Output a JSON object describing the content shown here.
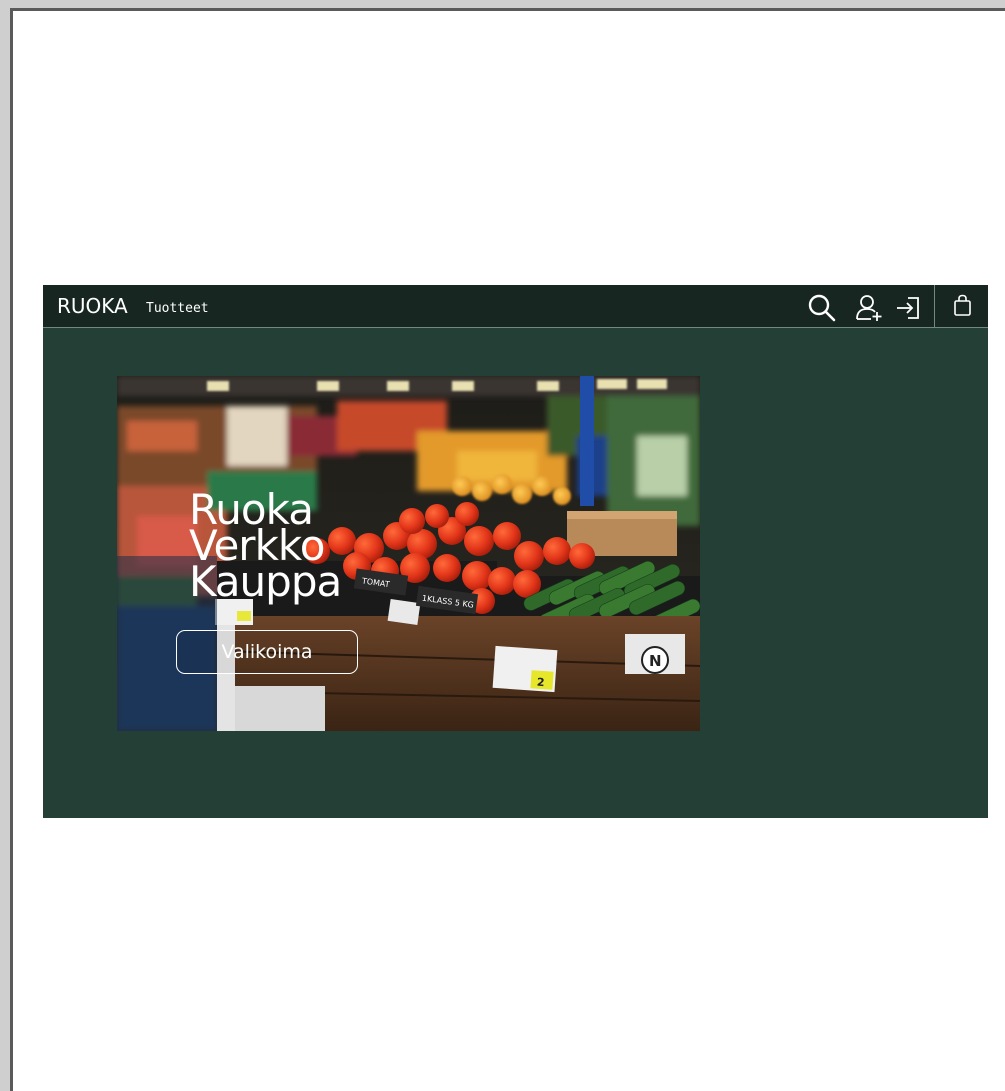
{
  "navbar": {
    "brand": "RUOKA",
    "link_products": "Tuotteet",
    "icons": [
      "search-icon",
      "add-user-icon",
      "login-icon",
      "shopping-bag-icon"
    ]
  },
  "hero": {
    "title_lines": [
      "Ruoka",
      "Verkko",
      "Kauppa"
    ],
    "cta_label": "Valikoima",
    "price_tags": [
      "TOMAT",
      "1KLASS 5 KG",
      "2",
      "N"
    ]
  },
  "colors": {
    "navbar_bg": "#172620",
    "page_bg": "#233f36",
    "text": "#ffffff"
  }
}
